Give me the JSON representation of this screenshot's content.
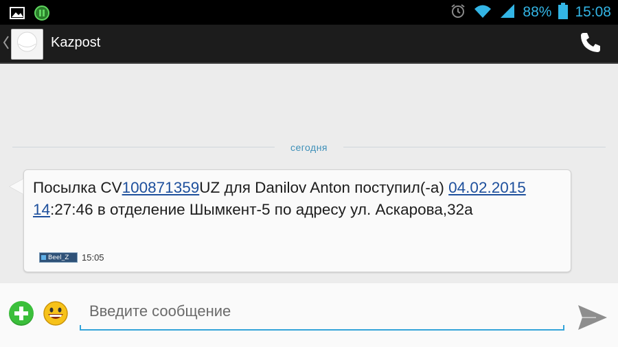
{
  "status_bar": {
    "battery": "88%",
    "time": "15:08",
    "icons": [
      "gallery-icon",
      "app-icon",
      "alarm-icon",
      "wifi-icon",
      "signal-icon",
      "battery-icon"
    ]
  },
  "action_bar": {
    "contact_name": "Kazpost",
    "icons": [
      "back-icon",
      "contact-avatar",
      "phone-icon"
    ]
  },
  "conversation": {
    "day_divider": "сегодня",
    "message": {
      "part1": "Посылка CV",
      "tracking_link": "100871359",
      "part2": "UZ для Danilov Anton поступил(-а) ",
      "date_link": "04.02.2015 14",
      "part3": ":27:46 в отделение Шымкент-5 по адресу ул. Аскарова,32а",
      "sim_label": "Beel_Z",
      "time": "15:05"
    }
  },
  "composer": {
    "placeholder": "Введите сообщение",
    "value": "",
    "icons": [
      "add-attachment-icon",
      "emoji-icon",
      "send-icon"
    ]
  },
  "colors": {
    "accent": "#33a3d9",
    "link": "#1d4f9c",
    "add_green": "#3bbf3b",
    "background": "#ececec"
  }
}
